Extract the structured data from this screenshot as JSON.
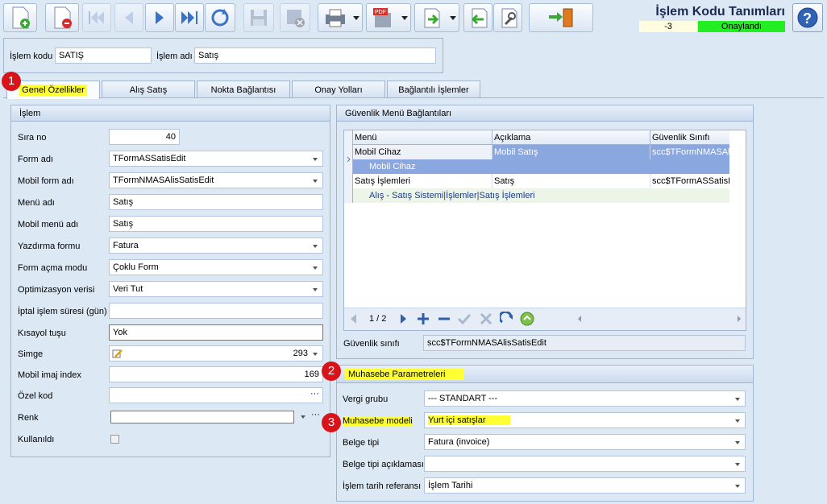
{
  "title": {
    "text": "İşlem Kodu Tanımları",
    "number": "-3",
    "status": "Onaylandı"
  },
  "toolbar": {
    "icons": [
      "new-document",
      "delete-document",
      "first-record",
      "previous-record",
      "next-record",
      "last-record",
      "refresh",
      "save",
      "cancel",
      "print",
      "pdf-export",
      "export",
      "import",
      "tools",
      "exit"
    ]
  },
  "header": {
    "code_label": "İşlem kodu",
    "code_value": "SATIŞ",
    "name_label": "İşlem adı",
    "name_value": "Satış"
  },
  "tabs": [
    {
      "label": "Genel Özellikler"
    },
    {
      "label": "Alış Satış"
    },
    {
      "label": "Nokta Bağlantısı"
    },
    {
      "label": "Onay Yolları"
    },
    {
      "label": "Bağlantılı İşlemler"
    }
  ],
  "islem": {
    "title": "İşlem",
    "fields": [
      {
        "label": "Sıra no",
        "value": "40"
      },
      {
        "label": "Form adı",
        "value": "TFormASSatisEdit"
      },
      {
        "label": "Mobil form adı",
        "value": "TFormNMASAlisSatisEdit"
      },
      {
        "label": "Menü adı",
        "value": "Satış"
      },
      {
        "label": "Mobil menü adı",
        "value": "Satış"
      },
      {
        "label": "Yazdırma formu",
        "value": "Fatura"
      },
      {
        "label": "Form açma modu",
        "value": "Çoklu Form"
      },
      {
        "label": "Optimizasyon verisi",
        "value": "Veri Tut"
      },
      {
        "label": "İptal işlem süresi (gün)",
        "value": ""
      },
      {
        "label": "Kısayol tuşu",
        "value": "Yok"
      },
      {
        "label": "Simge",
        "value": "293"
      },
      {
        "label": "Mobil imaj index",
        "value": "169"
      },
      {
        "label": "Özel kod",
        "value": ""
      },
      {
        "label": "Renk",
        "value": ""
      },
      {
        "label": "Kullanıldı",
        "value": ""
      }
    ]
  },
  "guvenlik": {
    "title": "Güvenlik Menü Bağlantıları",
    "columns": [
      "Menü",
      "Açıklama",
      "Güvenlik Sınıfı"
    ],
    "rows": [
      {
        "menu": "Mobil Cihaz",
        "aciklama": "Mobil Satış",
        "sinif": "scc$TFormNMASAlis",
        "detail": "Mobil Cihaz"
      },
      {
        "menu": "Satış İşlemleri",
        "aciklama": "Satış",
        "sinif": "scc$TFormASSatisE",
        "detail": "Alış - Satış Sistemi|İşlemler|Satış İşlemleri"
      }
    ],
    "pager": "1 / 2",
    "class_label": "Güvenlik sınıfı",
    "class_value": "scc$TFormNMASAlisSatisEdit"
  },
  "muhasebe": {
    "title": "Muhasebe Parametreleri",
    "fields": [
      {
        "label": "Vergi grubu",
        "value": "--- STANDART ---"
      },
      {
        "label": "Muhasebe modeli",
        "value": "Yurt içi satışlar"
      },
      {
        "label": "Belge tipi",
        "value": "Fatura (invoice)"
      },
      {
        "label": "Belge tipi açıklaması",
        "value": ""
      },
      {
        "label": "İşlem tarih referansı",
        "value": "İşlem Tarihi"
      }
    ]
  },
  "markers": [
    "1",
    "2",
    "3"
  ],
  "colors": {
    "highlight": "#ffff33",
    "approved": "#22ee22",
    "marker": "#d9131a",
    "selected_row": "#8aa7df"
  }
}
